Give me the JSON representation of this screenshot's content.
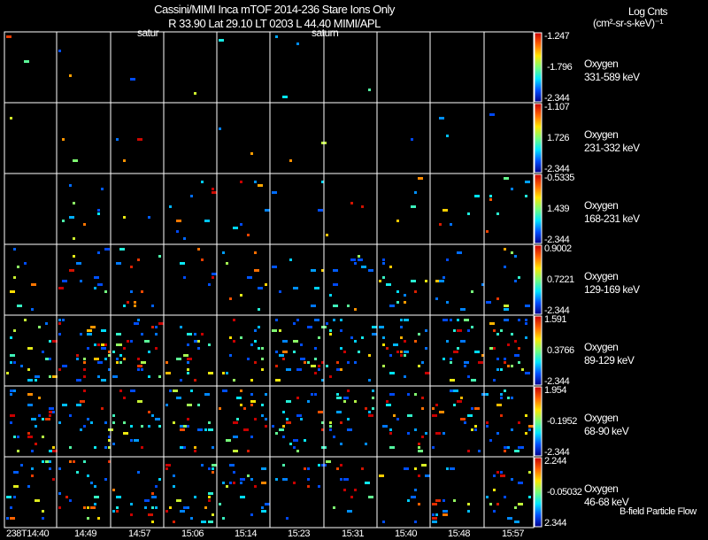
{
  "header": {
    "title": "Cassini/MIMI Inca mTOF  2014-236   Stare   Ions Only",
    "subtitle": "R        33.90 Lat 29.10 LT 0203 L          44.40  MIMI/APL",
    "label_left": "satur",
    "label_mid": "saturn",
    "units_line1": "Log Cnts",
    "units_line2": "(cm²-sr-s-keV)⁻¹"
  },
  "footer_label": "B-field Particle Flow",
  "chart_data": {
    "type": "heatmap",
    "x_tick_labels": [
      "238T14:40",
      "14:49",
      "14:57",
      "15:06",
      "15:14",
      "15:23",
      "15:31",
      "15:40",
      "15:48",
      "15:57"
    ],
    "colormap": "rainbow (blue-cyan-green-yellow-red)",
    "background": "#000000",
    "grid": true,
    "panels": [
      {
        "species": "Oxygen",
        "energy": "331-589 keV",
        "cmax": "-1.247",
        "cmid": "-1.796",
        "cmin": "-2.344",
        "density": 0.002
      },
      {
        "species": "Oxygen",
        "energy": "231-332 keV",
        "cmax": "-1.107",
        "cmid": "1.726",
        "cmin": "-2.344",
        "density": 0.004
      },
      {
        "species": "Oxygen",
        "energy": "168-231 keV",
        "cmax": "-0.5335",
        "cmid": "1.439",
        "cmin": "-2.344",
        "density": 0.02
      },
      {
        "species": "Oxygen",
        "energy": "129-169 keV",
        "cmax": "0.9002",
        "cmid": "0.7221",
        "cmin": "-2.344",
        "density": 0.04
      },
      {
        "species": "Oxygen",
        "energy": "89-129 keV",
        "cmax": "1.591",
        "cmid": "0.3766",
        "cmin": "-2.344",
        "density": 0.09
      },
      {
        "species": "Oxygen",
        "energy": "68-90 keV",
        "cmax": "1.954",
        "cmid": "-0.1952",
        "cmin": "-2.344",
        "density": 0.09
      },
      {
        "species": "Oxygen",
        "energy": "46-68 keV",
        "cmax": "2.244",
        "cmid": "-0.05032",
        "cmin": "2.344",
        "density": 0.07
      }
    ]
  }
}
